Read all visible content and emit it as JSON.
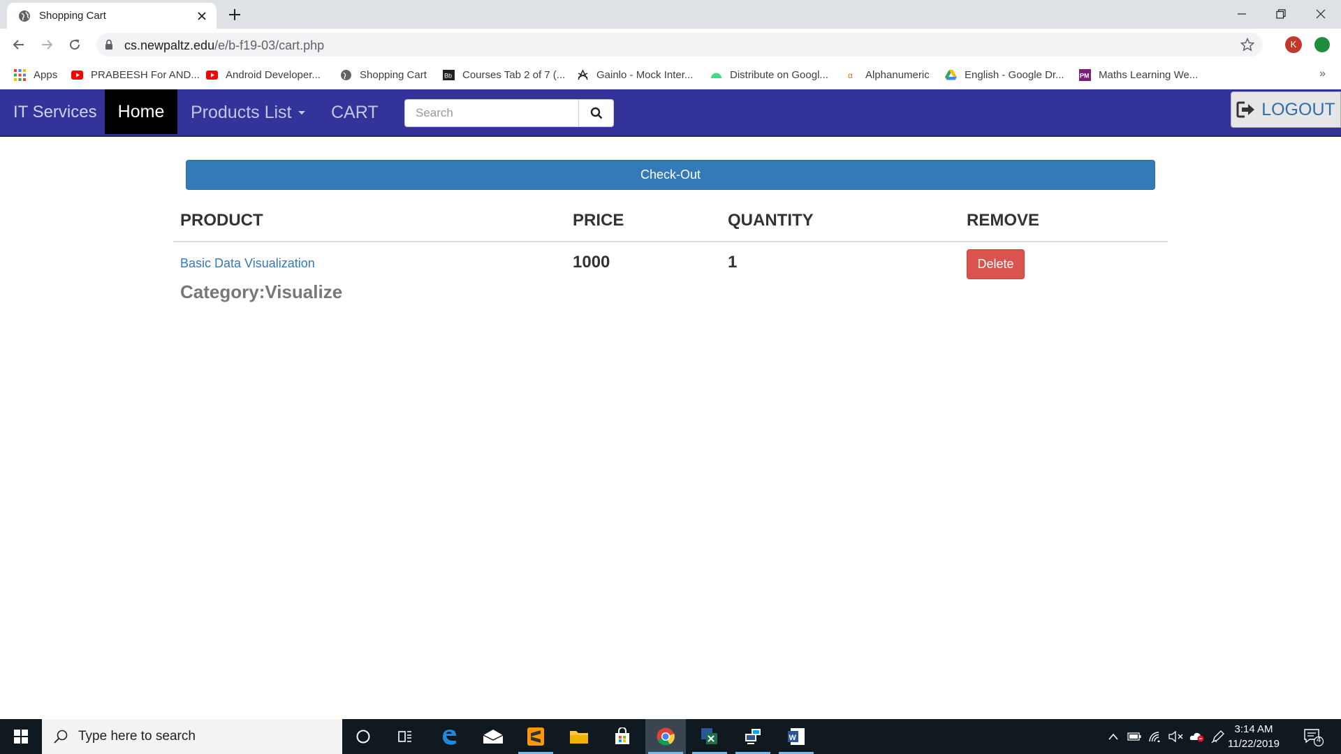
{
  "browser": {
    "tab_title": "Shopping Cart",
    "url_host": "cs.newpaltz.edu",
    "url_path": "/e/b-f19-03/cart.php",
    "profile_initial": "K",
    "bookmarks": [
      {
        "label": "Apps",
        "icon": "apps-grid-icon"
      },
      {
        "label": "PRABEESH For AND...",
        "icon": "youtube-icon"
      },
      {
        "label": "Android Developer...",
        "icon": "youtube-icon"
      },
      {
        "label": "Shopping Cart",
        "icon": "globe-icon"
      },
      {
        "label": "Courses Tab 2 of 7 (...",
        "icon": "blackboard-icon"
      },
      {
        "label": "Gainlo - Mock Inter...",
        "icon": "gainlo-icon"
      },
      {
        "label": "Distribute on Googl...",
        "icon": "android-icon"
      },
      {
        "label": "Alphanumeric",
        "icon": "alphanumeric-icon"
      },
      {
        "label": "English - Google Dr...",
        "icon": "google-drive-icon"
      },
      {
        "label": "Maths Learning We...",
        "icon": "pm-icon"
      }
    ],
    "bookmarks_more": "»"
  },
  "navbar": {
    "brand": "IT Services",
    "home": "Home",
    "products": "Products List",
    "cart": "CART",
    "search_placeholder": "Search",
    "logout": "LOGOUT"
  },
  "cart": {
    "checkout_label": "Check-Out",
    "headers": {
      "product": "PRODUCT",
      "price": "PRICE",
      "quantity": "QUANTITY",
      "remove": "REMOVE"
    },
    "items": [
      {
        "name": "Basic Data Visualization",
        "category": "Category:Visualize",
        "price": "1000",
        "quantity": "1",
        "delete_label": "Delete"
      }
    ]
  },
  "taskbar": {
    "search_placeholder": "Type here to search",
    "time": "3:14 AM",
    "date": "11/22/2019",
    "notification_count": "4"
  },
  "colors": {
    "navbar": "#333399",
    "checkout_button": "#337ab7",
    "delete_button": "#d9534f",
    "link": "#337ab7"
  }
}
